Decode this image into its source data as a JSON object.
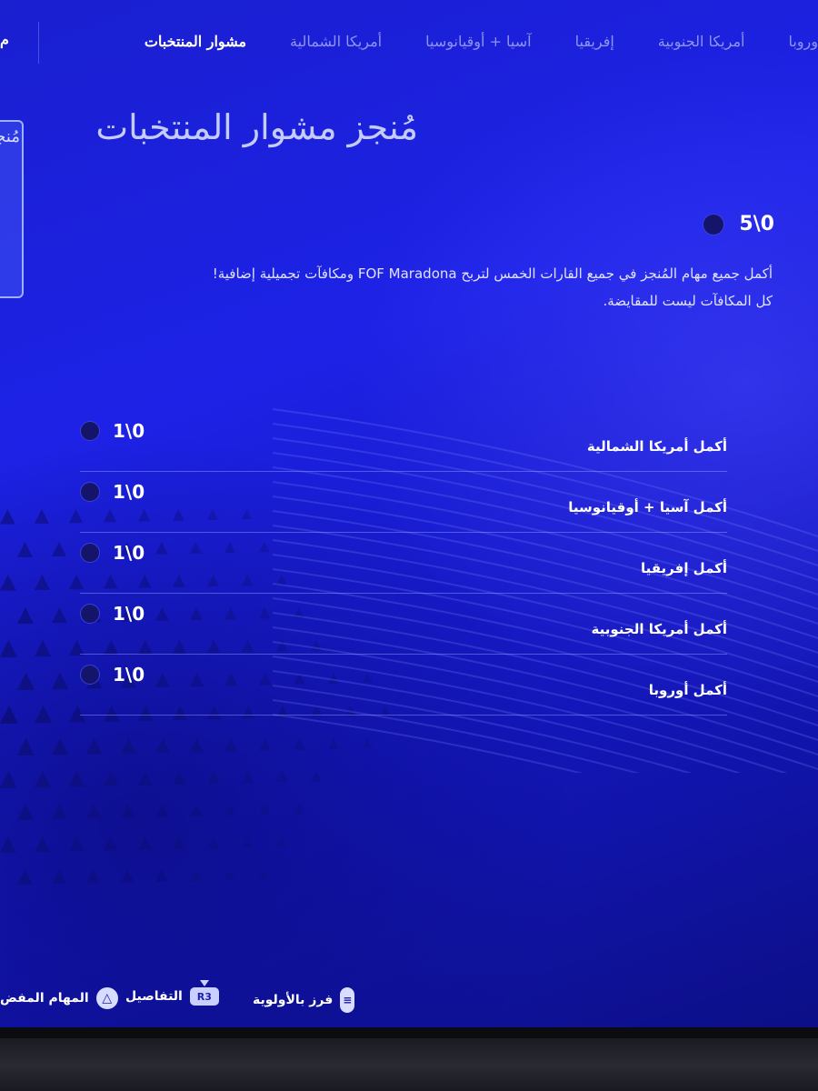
{
  "tabs": [
    {
      "label": "وروبا",
      "active": false
    },
    {
      "label": "أمريكا الجنوبية",
      "active": false
    },
    {
      "label": "إفريقيا",
      "active": false
    },
    {
      "label": "آسيا + أوقيانوسيا",
      "active": false
    },
    {
      "label": "أمريكا الشمالية",
      "active": false
    },
    {
      "label": "مشوار المنتخبات",
      "active": true
    }
  ],
  "tab_edge_label": "م",
  "side_card_text": "مُنجز",
  "page_title": "مُنجز مشوار المنتخبات",
  "overall_progress": "5\\0",
  "description": {
    "line1": "أكمل جميع مهام المُنجز في جميع القارات الخمس لتربح FOF Maradona ومكافآت تجميلية إضافية!",
    "line2": "كل المكافآت ليست للمقايضة."
  },
  "tasks": [
    {
      "label": "أكمل أمريكا الشمالية",
      "progress": "1\\0"
    },
    {
      "label": "أكمل آسيا + أوقيانوسيا",
      "progress": "1\\0"
    },
    {
      "label": "أكمل إفريقيا",
      "progress": "1\\0"
    },
    {
      "label": "أكمل أمريكا الجنوبية",
      "progress": "1\\0"
    },
    {
      "label": "أكمل أوروبا",
      "progress": "1\\0"
    }
  ],
  "hints": {
    "missions": {
      "label": "المهام المفض",
      "icon": "triangle-button-icon"
    },
    "details": {
      "label": "التفاصيل",
      "icon": "r3-button-icon",
      "icon_text": "R3"
    },
    "sort": {
      "label": "فرز بالأولوية",
      "icon": "options-button-icon"
    }
  },
  "colors": {
    "background": "#1d22e6",
    "text": "#ffffff",
    "inactive_tab": "#8f95f2",
    "title": "#c4ccff"
  }
}
